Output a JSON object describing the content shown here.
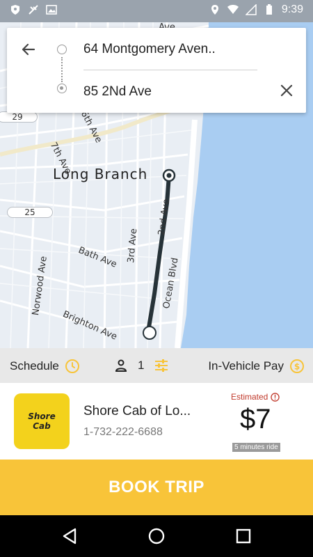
{
  "status_bar": {
    "time": "9:39",
    "icons": [
      "shield-icon",
      "satellite-icon",
      "image-icon",
      "location-icon",
      "wifi-icon",
      "signal-icon",
      "battery-icon"
    ]
  },
  "map": {
    "city_label": "Long Branch",
    "streets": [
      "7th Ave",
      "6th Ave",
      "Bath Ave",
      "3rd Ave",
      "2nd Ave",
      "Norwood Ave",
      "Ocean Blvd",
      "Brighton Ave"
    ],
    "route_badges": [
      "29",
      "25"
    ],
    "top_street_fragment": "Ave"
  },
  "address": {
    "pickup": "64 Montgomery Aven..",
    "destination": "85 2Nd Ave"
  },
  "options": {
    "schedule_label": "Schedule",
    "passengers": "1",
    "payment_label": "In-Vehicle Pay"
  },
  "provider": {
    "logo_text_1": "Shore",
    "logo_text_2": "Cab",
    "name": "Shore Cab of Lo...",
    "phone": "1-732-222-6688",
    "estimated_label": "Estimated",
    "price": "$7",
    "ride_time": "5 minutes ride"
  },
  "book_button": "BOOK TRIP",
  "colors": {
    "accent": "#f8c439",
    "logo_bg": "#f3d21c",
    "water": "#a9cdf2",
    "estimated": "#c0392b"
  }
}
